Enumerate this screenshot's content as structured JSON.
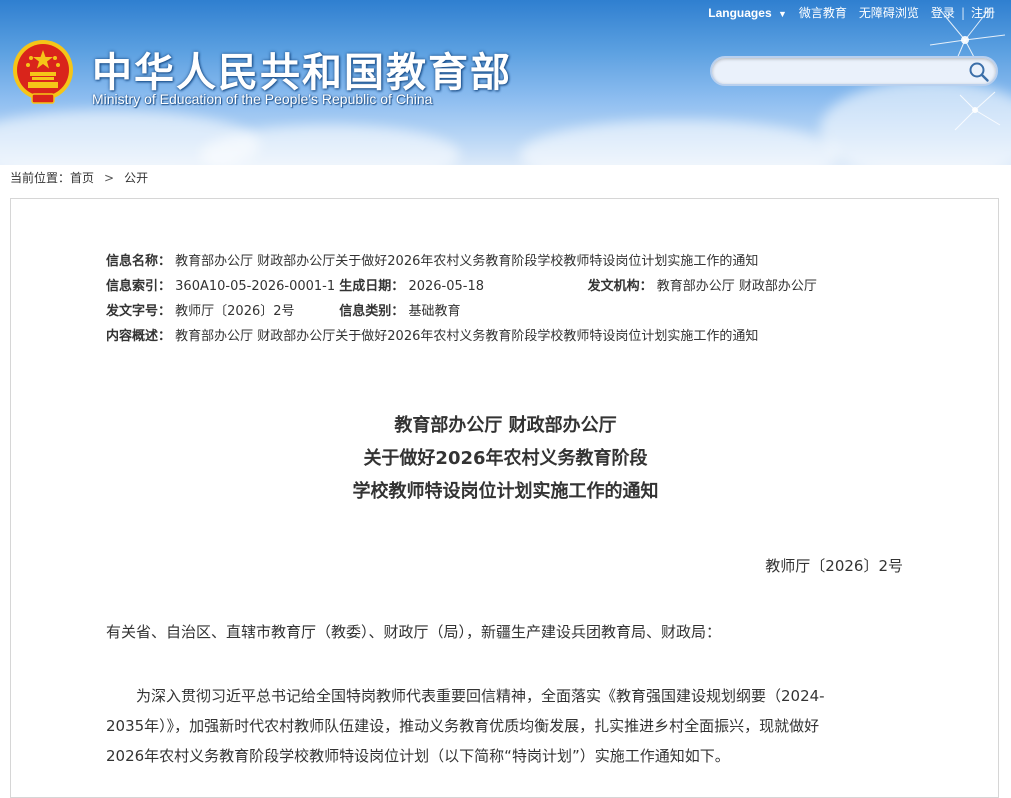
{
  "top_nav": {
    "languages": "Languages",
    "wechat": "微言教育",
    "accessibility": "无障碍浏览",
    "login": "登录",
    "logout": "注册"
  },
  "header": {
    "title_cn": "中华人民共和国教育部",
    "title_en": "Ministry of Education of the People's Republic of China"
  },
  "search": {
    "placeholder": "",
    "value": ""
  },
  "breadcrumb": {
    "prefix": "当前位置：",
    "home": "首页",
    "section": "公开"
  },
  "meta": {
    "name_label": "信息名称：",
    "name_value": "教育部办公厅 财政部办公厅关于做好2026年农村义务教育阶段学校教师特设岗位计划实施工作的通知",
    "index_label": "信息索引：",
    "index_value": "360A10-05-2026-0001-1",
    "date_label": "生成日期：",
    "date_value": "2026-05-18",
    "org_label": "发文机构：",
    "org_value": "教育部办公厅 财政部办公厅",
    "docno_label": "发文字号：",
    "docno_value": "教师厅〔2026〕2号",
    "category_label": "信息类别：",
    "category_value": "基础教育",
    "summary_label": "内容概述：",
    "summary_value": "教育部办公厅 财政部办公厅关于做好2026年农村义务教育阶段学校教师特设岗位计划实施工作的通知"
  },
  "document": {
    "title_line1": "教育部办公厅 财政部办公厅",
    "title_line2": "关于做好2026年农村义务教育阶段",
    "title_line3": "学校教师特设岗位计划实施工作的通知",
    "doc_number": "教师厅〔2026〕2号",
    "salutation": "有关省、自治区、直辖市教育厅（教委）、财政厅（局），新疆生产建设兵团教育局、财政局：",
    "para1_line1": "为深入贯彻习近平总书记给全国特岗教师代表重要回信精神，全面落实《教育强国建设规划纲要（2024-",
    "para1_line2": "2035年）》，加强新时代农村教师队伍建设，推动义务教育优质均衡发展，扎实推进乡村全面振兴，现就做好",
    "para1_line3": "2026年农村义务教育阶段学校教师特设岗位计划（以下简称“特岗计划”）实施工作通知如下。"
  },
  "colors": {
    "header_blue": "#2f7fd0",
    "emblem_red": "#d9241b",
    "emblem_gold": "#f5c518"
  }
}
